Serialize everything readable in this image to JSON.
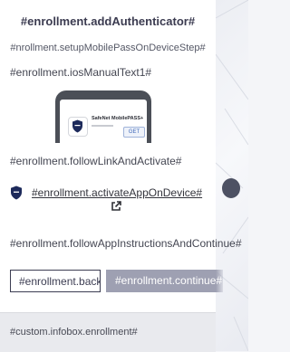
{
  "enrollment": {
    "title": "#enrollment.addAuthenticator#",
    "subtitle": "#nrollment.setupMobilePassOnDeviceStep#",
    "ios_manual_text": "#enrollment.iosManualText1#",
    "follow_link_text": "#enrollment.followLinkAndActivate#",
    "activate_link": "#enrollment.activateAppOnDevice#",
    "follow_instructions_text": "#enrollment.followAppInstructionsAndContinue#",
    "back_button": "#enrollment.back#",
    "continue_button": "#enrollment.continue#"
  },
  "app_store_preview": {
    "app_name": "SafeNet MobilePASS+",
    "get_label": "GET"
  },
  "footer": {
    "infobox_text": "#custom.infobox.enrollment#"
  },
  "icons": {
    "shield": "shield-icon",
    "external_link": "external-link-icon",
    "app": "mobilepass-app-icon"
  },
  "colors": {
    "title": "#3b3b50",
    "continue_button_bg": "#9ea0b2",
    "shield": "#1d2a5b",
    "footer_bg": "#e9eaee"
  }
}
